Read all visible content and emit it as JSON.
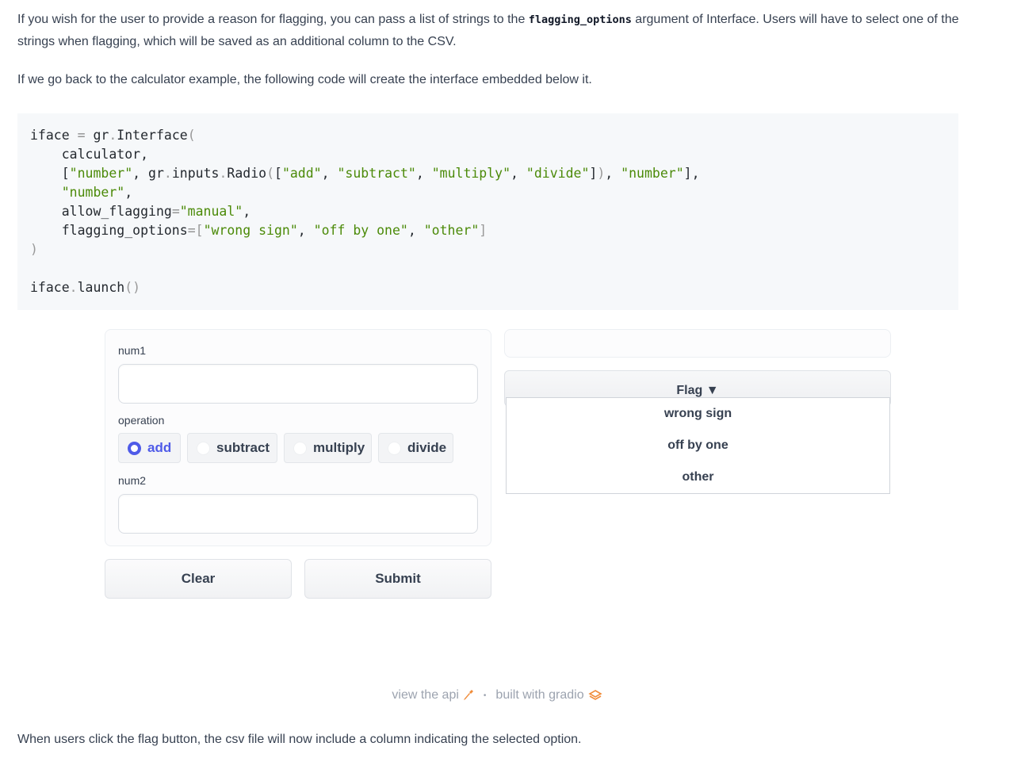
{
  "intro": {
    "p1_before": "If you wish for the user to provide a reason for flagging, you can pass a list of strings to the ",
    "p1_code": "flagging_options",
    "p1_after": " argument of Interface. Users will have to select one of the strings when flagging, which will be saved as an additional column to the CSV.",
    "p2": "If we go back to the calculator example, the following code will create the interface embedded below it."
  },
  "code": {
    "l1_a": "iface ",
    "l1_op": "=",
    "l1_b": " gr",
    "l1_dot": ".",
    "l1_c": "Interface",
    "l1_paren": "(",
    "l2": "    calculator,",
    "l3_a": "    [",
    "l3_s1": "\"number\"",
    "l3_b": ", gr",
    "l3_d1": ".",
    "l3_c": "inputs",
    "l3_d2": ".",
    "l3_e": "Radio",
    "l3_p1": "(",
    "l3_f": "[",
    "l3_s2": "\"add\"",
    "l3_g": ", ",
    "l3_s3": "\"subtract\"",
    "l3_h": ", ",
    "l3_s4": "\"multiply\"",
    "l3_i": ", ",
    "l3_s5": "\"divide\"",
    "l3_j": "]",
    "l3_p2": ")",
    "l3_k": ", ",
    "l3_s6": "\"number\"",
    "l3_l": "],",
    "l4_a": "    ",
    "l4_s": "\"number\"",
    "l4_b": ",",
    "l5_a": "    allow_flagging",
    "l5_op": "=",
    "l5_s": "\"manual\"",
    "l5_b": ",",
    "l6_a": "    flagging_options",
    "l6_op": "=",
    "l6_b": "[",
    "l6_s1": "\"wrong sign\"",
    "l6_c": ", ",
    "l6_s2": "\"off by one\"",
    "l6_d": ", ",
    "l6_s3": "\"other\"",
    "l6_e": "]",
    "l7": ")",
    "l9_a": "iface",
    "l9_dot": ".",
    "l9_b": "launch",
    "l9_p": "()"
  },
  "demo": {
    "num1_label": "num1",
    "operation_label": "operation",
    "operations": [
      "add",
      "subtract",
      "multiply",
      "divide"
    ],
    "selected_operation": "add",
    "num2_label": "num2",
    "clear_label": "Clear",
    "submit_label": "Submit",
    "flag_label": "Flag ▼",
    "flag_options": [
      "wrong sign",
      "off by one",
      "other"
    ],
    "accent_color": "#4f5be8"
  },
  "footer": {
    "api_link": "view the api",
    "separator": "•",
    "built_with": "built with gradio",
    "icon_color": "#f08c3a"
  },
  "outro": "When users click the flag button, the csv file will now include a column indicating the selected option."
}
